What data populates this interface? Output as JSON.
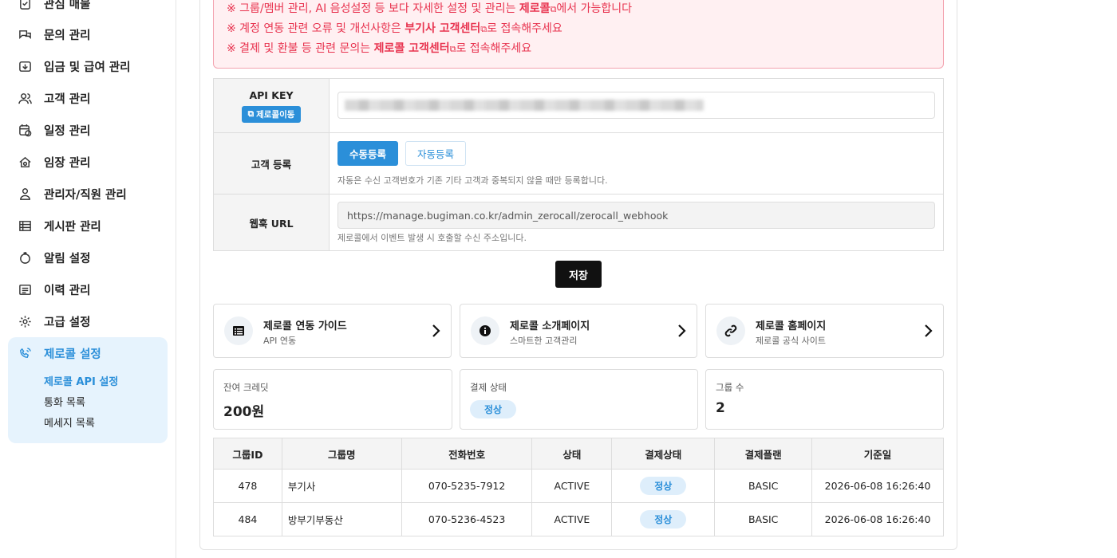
{
  "sidebar": {
    "items": [
      {
        "label": "관심 매물",
        "icon": "favorite-listing-icon"
      },
      {
        "label": "문의 관리",
        "icon": "inquiry-icon"
      },
      {
        "label": "입금 및 급여 관리",
        "icon": "deposit-icon"
      },
      {
        "label": "고객 관리",
        "icon": "customers-icon"
      },
      {
        "label": "일정 관리",
        "icon": "schedule-icon"
      },
      {
        "label": "임장 관리",
        "icon": "site-visit-icon"
      },
      {
        "label": "관리자/직원 관리",
        "icon": "staff-icon"
      },
      {
        "label": "게시판 관리",
        "icon": "board-icon"
      },
      {
        "label": "알림 설정",
        "icon": "notification-icon"
      },
      {
        "label": "이력 관리",
        "icon": "history-icon"
      },
      {
        "label": "고급 설정",
        "icon": "gear-icon"
      }
    ],
    "active": {
      "label": "제로콜 설정",
      "icon": "phone-call-icon",
      "subs": [
        "제로콜 API 설정",
        "통화 목록",
        "메세지 목록"
      ]
    }
  },
  "notice": {
    "line1_pre": "※ 그룹/멤버 관리, AI 음성설정 등 보다 자세한 설정 및 관리는 ",
    "line1_link": "제로콜",
    "line1_post": "에서 가능합니다",
    "line2_pre": "※ 계정 연동 관련 오류 및 개선사항은 ",
    "line2_link": "부기사 고객센터",
    "line2_post": "로 접속해주세요",
    "line3_pre": "※ 결제 및 환불 등 관련 문의는 ",
    "line3_link": "제로콜 고객센터",
    "line3_post": "로 접속해주세요"
  },
  "form": {
    "api_key_label": "API KEY",
    "api_key_link": "제로콜이동",
    "customer_reg_label": "고객 등록",
    "manual_btn": "수동등록",
    "auto_btn": "자동등록",
    "customer_reg_help": "자동은 수신 고객번호가 기존 기타 고객과 중복되지 않을 때만 등록합니다.",
    "webhook_label": "웹훅 URL",
    "webhook_value": "https://manage.bugiman.co.kr/admin_zerocall/zerocall_webhook",
    "webhook_help": "제로콜에서 이벤트 발생 시 호출할 수신 주소입니다."
  },
  "save_label": "저장",
  "cards": [
    {
      "title": "제로콜 연동 가이드",
      "sub": "API 연동",
      "icon": "list-icon"
    },
    {
      "title": "제로콜 소개페이지",
      "sub": "스마트한 고객관리",
      "icon": "info-icon"
    },
    {
      "title": "제로콜 홈페이지",
      "sub": "제로콜 공식 사이트",
      "icon": "link-icon"
    }
  ],
  "stats": {
    "credit_label": "잔여 크레딧",
    "credit_value": "200원",
    "payment_label": "결제 상태",
    "payment_value": "정상",
    "groups_label": "그룹 수",
    "groups_value": "2"
  },
  "table": {
    "headers": [
      "그룹ID",
      "그룹명",
      "전화번호",
      "상태",
      "결제상태",
      "결제플랜",
      "기준일"
    ],
    "rows": [
      [
        "478",
        "부기사",
        "070-5235-7912",
        "ACTIVE",
        "정상",
        "BASIC",
        "2026-06-08 16:26:40"
      ],
      [
        "484",
        "방부기부동산",
        "070-5236-4523",
        "ACTIVE",
        "정상",
        "BASIC",
        "2026-06-08 16:26:40"
      ]
    ]
  },
  "colors": {
    "accent": "#2b8fd9",
    "alert": "#e8334f",
    "dark_button": "#111111"
  }
}
